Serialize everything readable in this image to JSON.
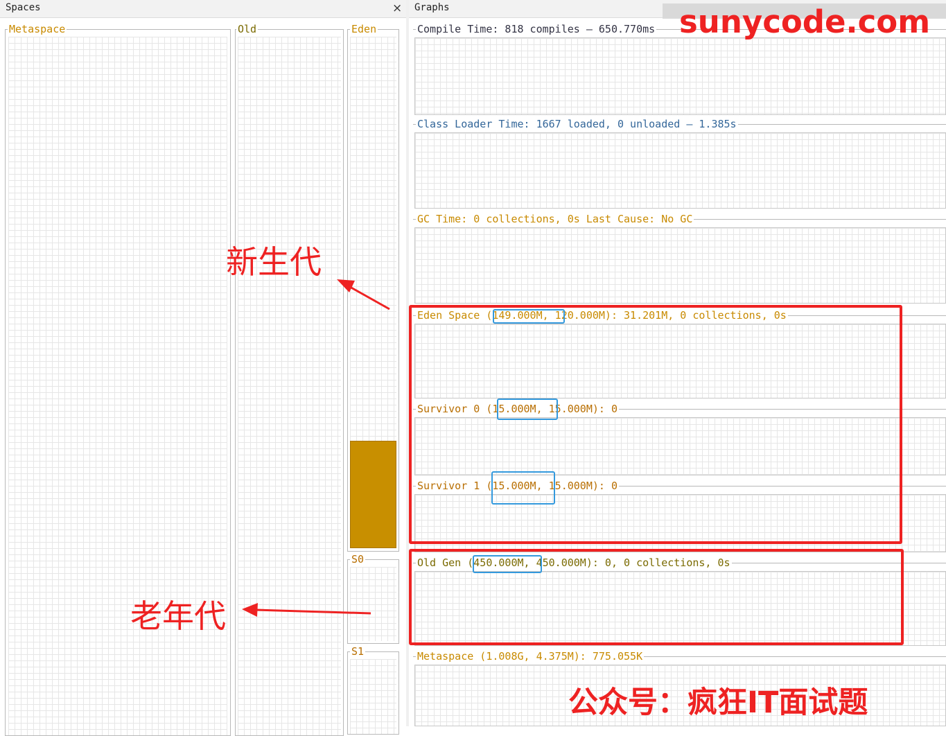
{
  "spaces_panel": {
    "title": "Spaces",
    "close_glyph": "×",
    "metaspace_label": "Metaspace",
    "old_label": "Old",
    "eden_label": "Eden",
    "s0_label": "S0",
    "s1_label": "S1",
    "eden_fill_fraction": 0.21,
    "fill_color": "#c88f00"
  },
  "graphs_panel": {
    "title": "Graphs",
    "compile_time": "Compile Time: 818 compiles – 650.770ms",
    "class_loader_time": "Class Loader Time: 1667 loaded, 0 unloaded – 1.385s",
    "gc_time": "GC Time: 0 collections, 0s Last Cause: No GC",
    "eden_space": "Eden Space (149.000M, 120.000M): 31.201M, 0 collections, 0s",
    "survivor0": "Survivor 0 (15.000M, 15.000M): 0",
    "survivor1": "Survivor 1 (15.000M, 15.000M): 0",
    "old_gen": "Old Gen (450.000M, 450.000M): 0, 0 collections, 0s",
    "metaspace": "Metaspace (1.008G, 4.375M): 775.055K"
  },
  "annotations": {
    "young_gen": "新生代",
    "old_gen": "老年代",
    "watermark_top": "sunycode.com",
    "watermark_bottom": "公众号：疯狂IT面试题",
    "highlight_color": "#ee2222",
    "max_size_highlight_color": "#3399dd"
  }
}
